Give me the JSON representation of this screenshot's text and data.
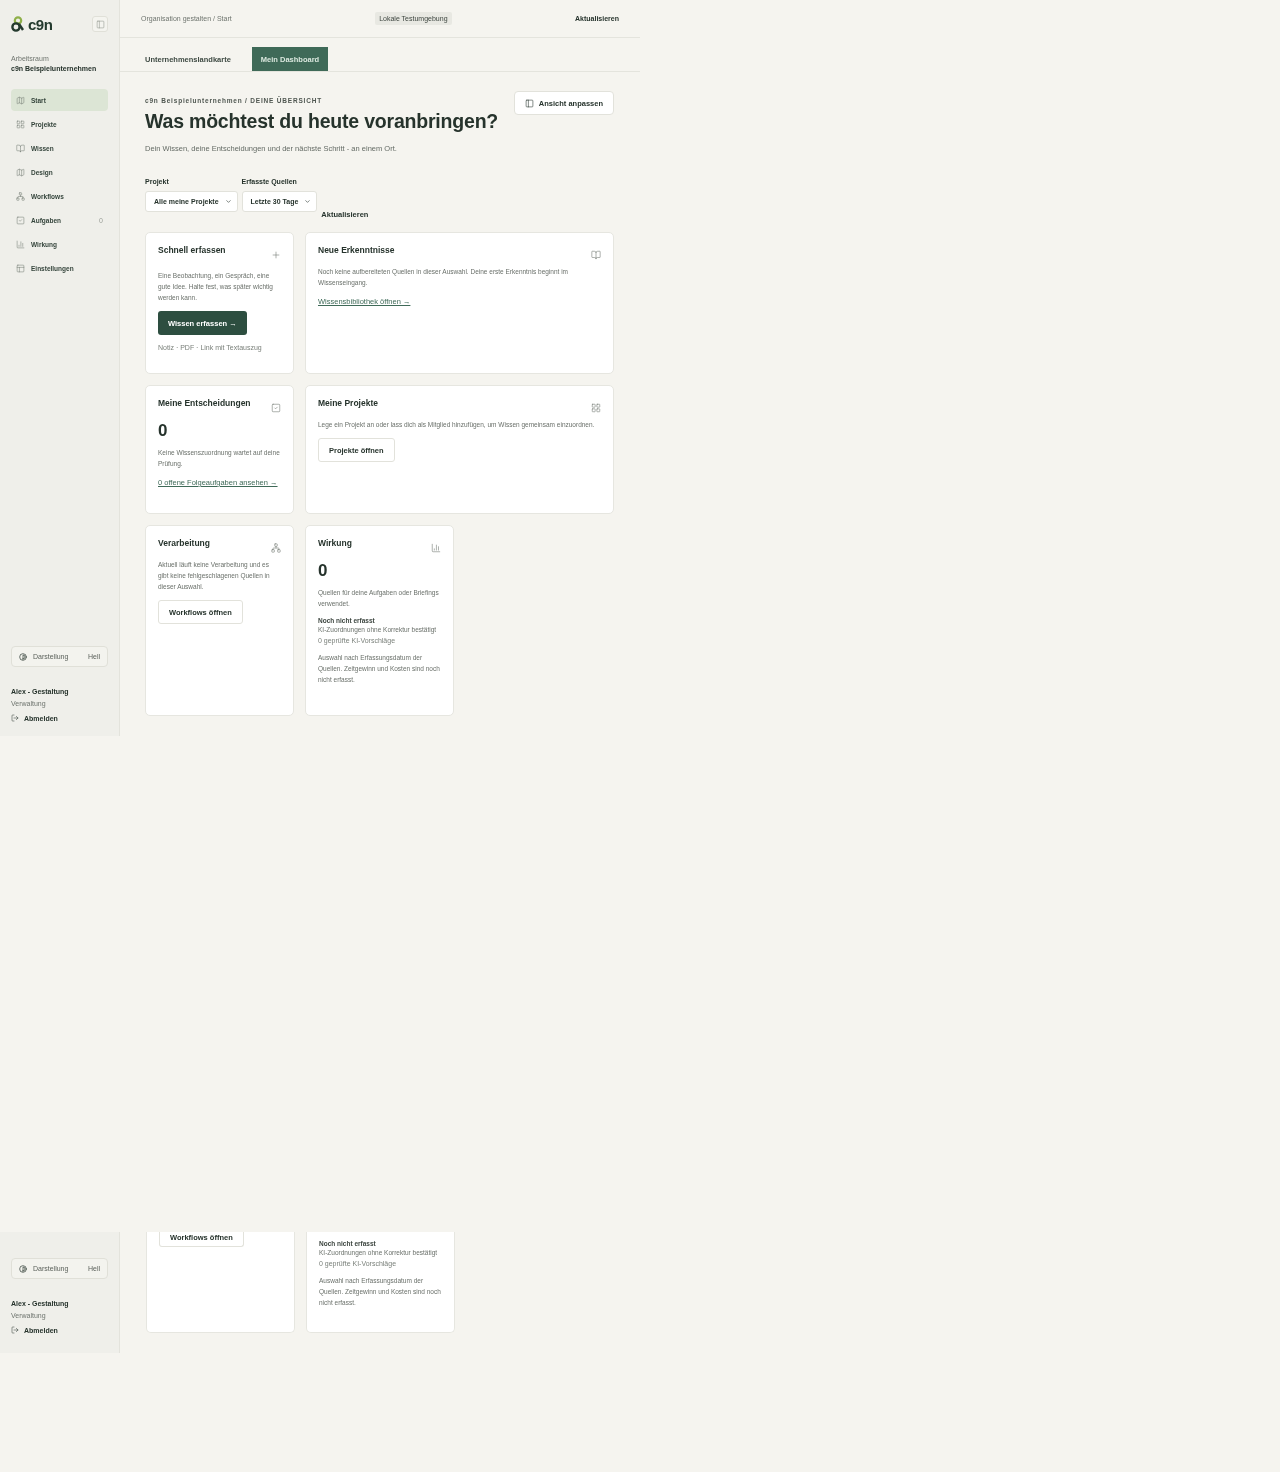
{
  "sidebar": {
    "logo": "c9n",
    "workspace_label": "Arbeitsraum",
    "workspace_name": "c9n Beispielunternehmen",
    "items": [
      {
        "label": "Start",
        "selected": true
      },
      {
        "label": "Projekte",
        "selected": false
      },
      {
        "label": "Wissen",
        "selected": false
      },
      {
        "label": "Design",
        "selected": false
      },
      {
        "label": "Workflows",
        "selected": false
      },
      {
        "label": "Aufgaben",
        "selected": false,
        "badge": "0"
      },
      {
        "label": "Wirkung",
        "selected": false
      },
      {
        "label": "Einstellungen",
        "selected": false
      }
    ],
    "theme": {
      "label": "Darstellung",
      "value": "Hell"
    },
    "user": {
      "name": "Alex - Gestaltung",
      "role": "Verwaltung",
      "logout": "Abmelden"
    }
  },
  "topbar": {
    "breadcrumb": "Organisation gestalten / Start",
    "environment": "Lokale Testumgebung",
    "refresh": "Aktualisieren"
  },
  "tabs": [
    {
      "label": "Unternehmenslandkarte",
      "selected": false
    },
    {
      "label": "Mein Dashboard",
      "selected": true
    }
  ],
  "header": {
    "eyebrow": "c9n Beispielunternehmen / DEINE ÜBERSICHT",
    "title": "Was möchtest du heute voranbringen?",
    "subtitle": "Dein Wissen, deine Entscheidungen und der nächste Schritt - an einem Ort.",
    "customize": "Ansicht anpassen"
  },
  "filters": [
    {
      "label": "Projekt",
      "value": "Alle meine Projekte"
    },
    {
      "label": "Erfasste Quellen",
      "value": "Letzte 30 Tage"
    }
  ],
  "refresh": "Aktualisieren",
  "cards": [
    {
      "kind": "capture",
      "title": "Schnell erfassen",
      "text": "Eine Beobachtung, ein Gespräch, eine gute Idee. Halte fest, was später wichtig werden kann.",
      "button": "Wissen erfassen →",
      "hint": "Notiz · PDF · Link mit Textauszug"
    },
    {
      "kind": "insights",
      "title": "Neue Erkenntnisse",
      "text": "Noch keine aufbereiteten Quellen in dieser Auswahl. Deine erste Erkenntnis beginnt im Wissenseingang.",
      "link": "Wissensbibliothek öffnen →"
    },
    {
      "kind": "decisions",
      "title": "Meine Entscheidungen",
      "count": "0",
      "text": "Keine Wissenszuordnung wartet auf deine Prüfung.",
      "link": "0 offene Folgeaufgaben ansehen →"
    },
    {
      "kind": "projects",
      "title": "Meine Projekte",
      "text": "Lege ein Projekt an oder lass dich als Mitglied hinzufügen, um Wissen gemeinsam einzuordnen.",
      "button": "Projekte öffnen"
    },
    {
      "kind": "processing",
      "title": "Verarbeitung",
      "text": "Aktuell läuft keine Verarbeitung und es gibt keine fehlgeschlagenen Quellen in dieser Auswahl.",
      "button": "Workflows öffnen"
    },
    {
      "kind": "impact",
      "title": "Wirkung",
      "count": "0",
      "text": "Quellen für deine Aufgaben oder Briefings verwendet.",
      "subtitle": "Noch nicht erfasst",
      "subtext": "KI-Zuordnungen ohne Korrektur bestätigt",
      "fineprint": "0 geprüfte KI-Vorschläge",
      "note": "Auswahl nach Erfassungsdatum der Quellen. Zeitgewinn und Kosten sind noch nicht erfasst."
    }
  ],
  "repeated_fragment": {
    "theme": {
      "label": "Darstellung",
      "value": "Hell"
    },
    "user": {
      "name": "Alex - Gestaltung",
      "role": "Verwaltung",
      "logout": "Abmelden"
    },
    "button": "Workflows öffnen",
    "subtitle": "Noch nicht erfasst",
    "subtext": "KI-Zuordnungen ohne Korrektur bestätigt",
    "fineprint": "0 geprüfte KI-Vorschläge",
    "note": "Auswahl nach Erfassungsdatum der Quellen. Zeitgewinn und Kosten sind noch nicht erfasst."
  }
}
